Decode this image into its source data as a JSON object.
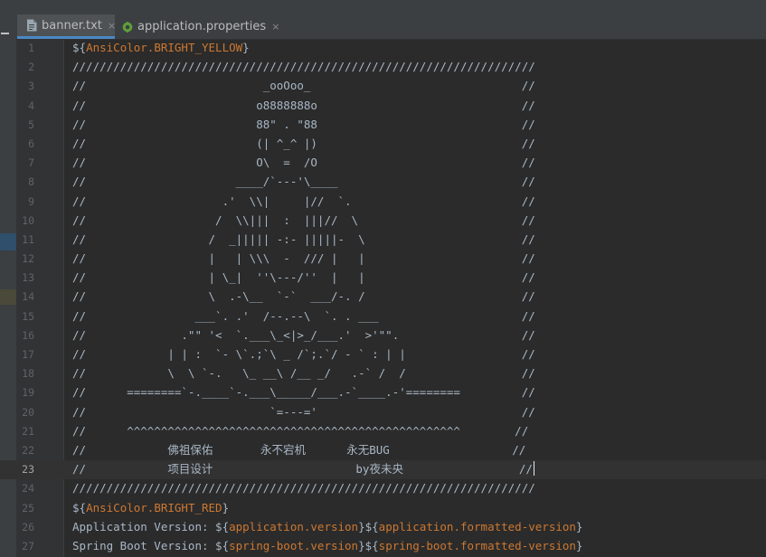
{
  "tabs": [
    {
      "label": "banner.txt",
      "icon": "text-file-icon",
      "active": true
    },
    {
      "label": "application.properties",
      "icon": "spring-properties-icon",
      "active": false
    }
  ],
  "close_glyph": "×",
  "caret_line": 23,
  "lines": [
    [
      "${",
      {
        "t": "AnsiColor.BRIGHT_YELLOW",
        "c": "var"
      },
      "}"
    ],
    [
      "////////////////////////////////////////////////////////////////////"
    ],
    [
      "//                          _ooOoo_                               //"
    ],
    [
      "//                         o8888888o                              //"
    ],
    [
      "//                         88\" . \"88                              //"
    ],
    [
      "//                         (| ^_^ |)                              //"
    ],
    [
      "//                         O\\  =  /O                              //"
    ],
    [
      "//                      ____/`---'\\____                           //"
    ],
    [
      "//                    .'  \\\\|     |//  `.                         //"
    ],
    [
      "//                   /  \\\\|||  :  |||//  \\                        //"
    ],
    [
      "//                  /  _||||| -:- |||||-  \\                       //"
    ],
    [
      "//                  |   | \\\\\\  -  /// |   |                       //"
    ],
    [
      "//                  | \\_|  ''\\---/''  |   |                       //"
    ],
    [
      "//                  \\  .-\\__  `-`  ___/-. /                       //"
    ],
    [
      "//                ___`. .'  /--.--\\  `. . ___                     //"
    ],
    [
      "//              .\"\" '<  `.___\\_<|>_/___.'  >'\"\".                  //"
    ],
    [
      "//            | | :  `- \\`.;`\\ _ /`;.`/ - ` : | |                 //"
    ],
    [
      "//            \\  \\ `-.   \\_ __\\ /__ _/   .-` /  /                 //"
    ],
    [
      "//      ========`-.____`-.___\\_____/___.-`____.-'========         //"
    ],
    [
      "//                           `=---='                              //"
    ],
    [
      "//      ^^^^^^^^^^^^^^^^^^^^^^^^^^^^^^^^^^^^^^^^^^^^^^^^^        //"
    ],
    [
      "//            佛祖保佑       永不宕机      永无BUG                  //"
    ],
    [
      "//            项目设计                     by夜未央                 //"
    ],
    [
      "////////////////////////////////////////////////////////////////////"
    ],
    [
      "${",
      {
        "t": "AnsiColor.BRIGHT_RED",
        "c": "var"
      },
      "}"
    ],
    [
      "Application Version: ${",
      {
        "t": "application.version",
        "c": "var"
      },
      "}${",
      {
        "t": "application.formatted-version",
        "c": "var"
      },
      "}"
    ],
    [
      "Spring Boot Version: ${",
      {
        "t": "spring-boot.version",
        "c": "var"
      },
      "}${",
      {
        "t": "spring-boot.formatted-version",
        "c": "var"
      },
      "}"
    ]
  ]
}
